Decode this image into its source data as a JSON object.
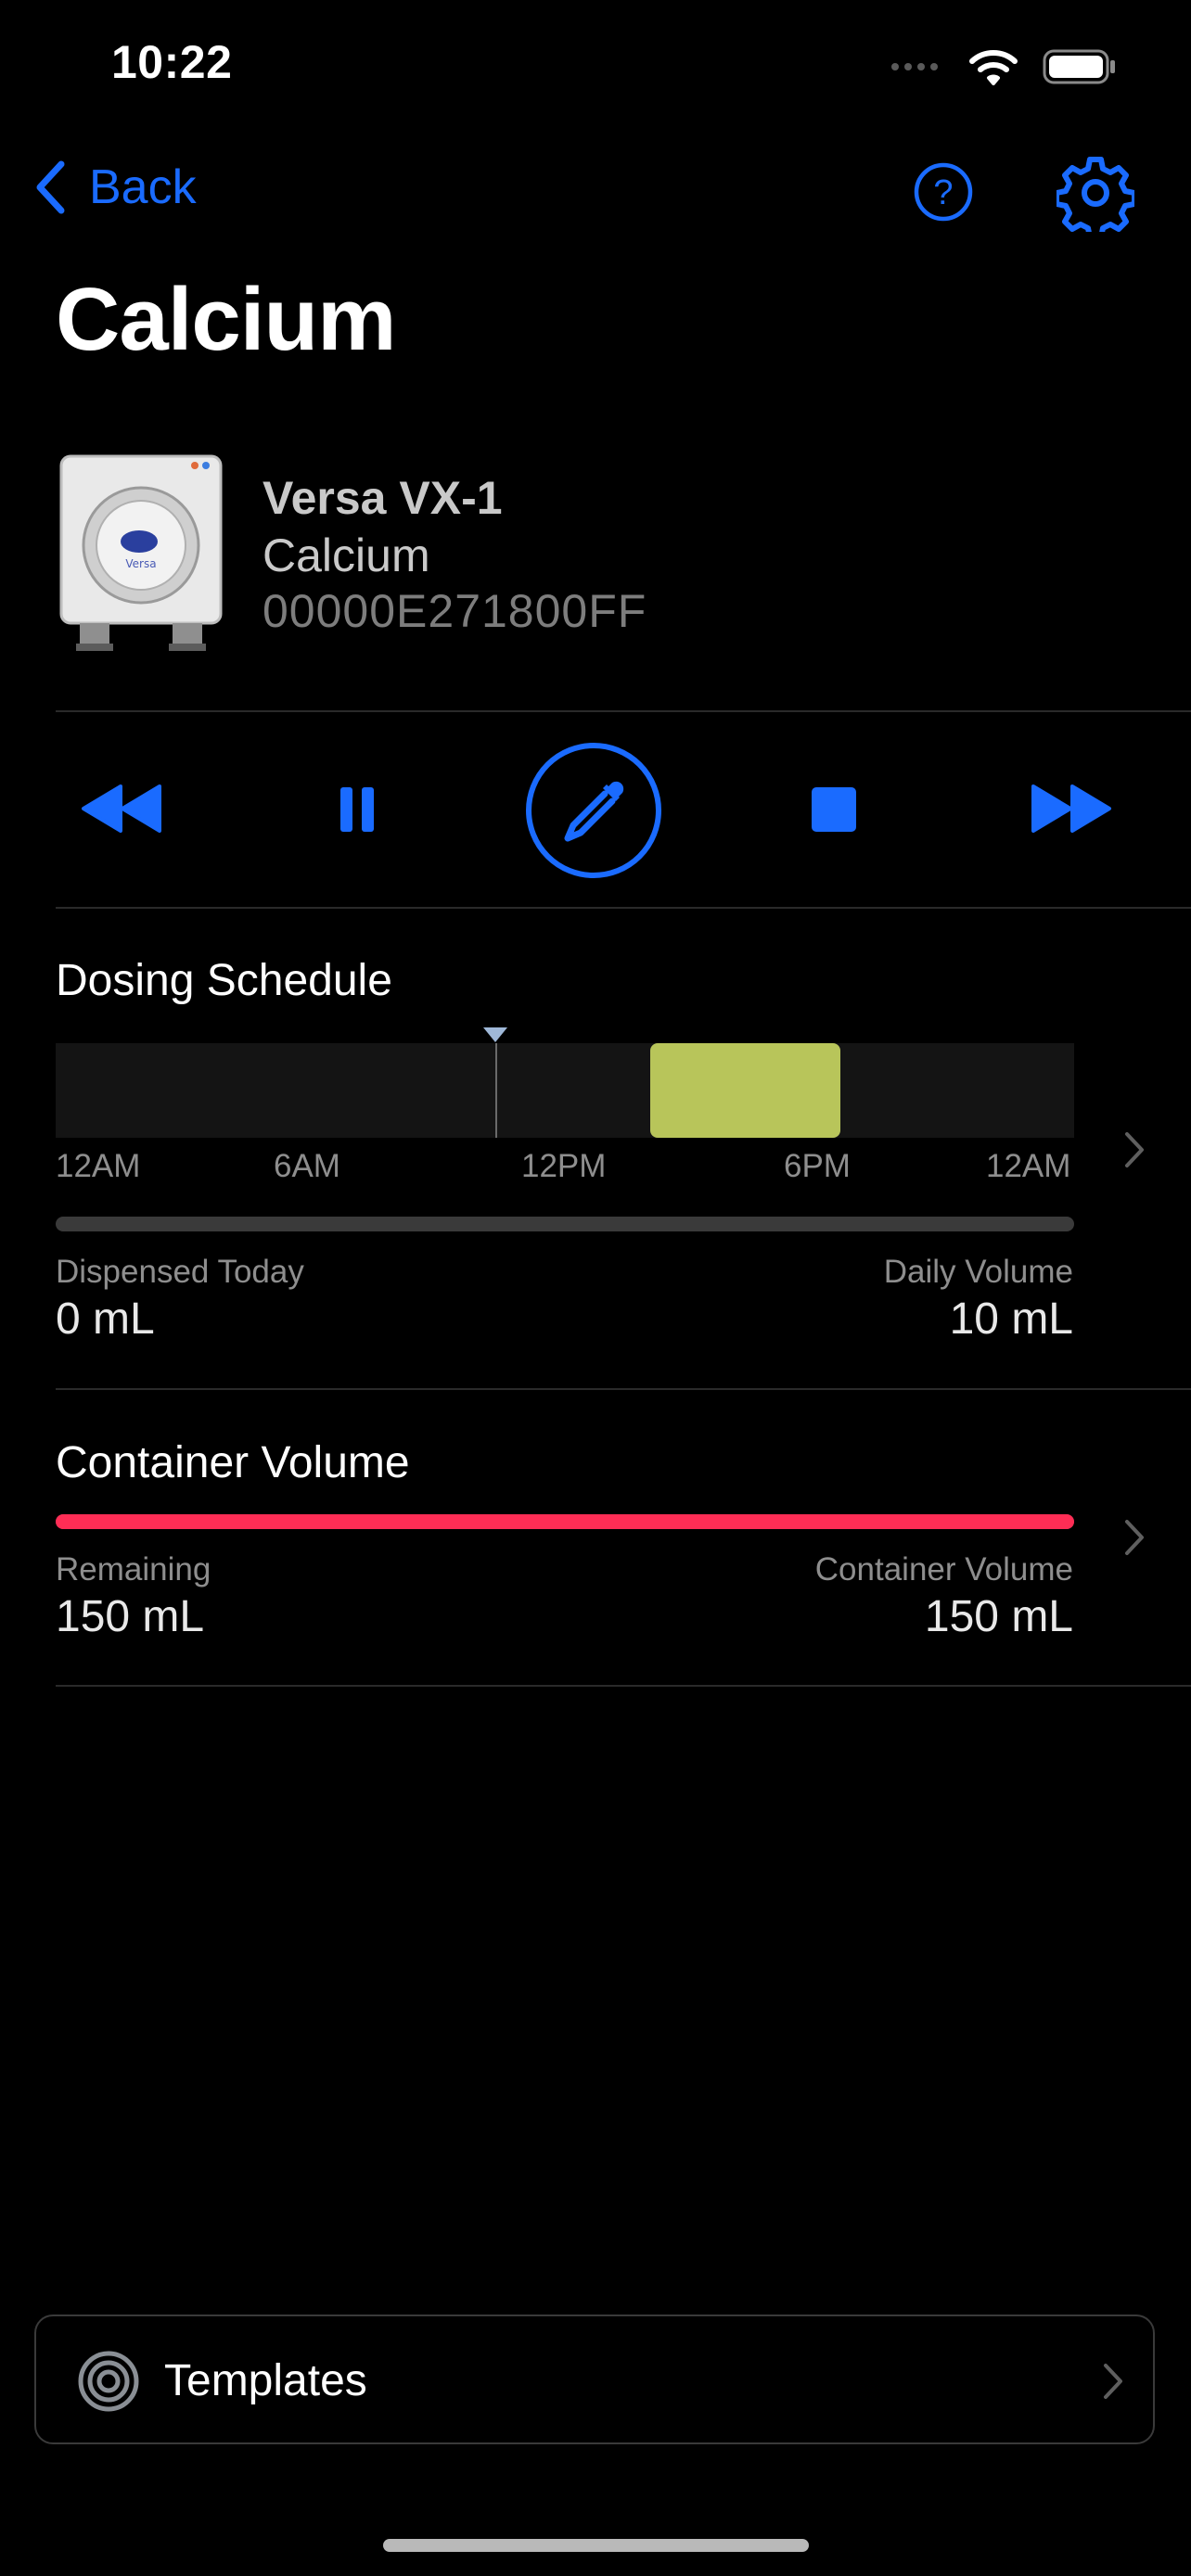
{
  "status_bar": {
    "time": "10:22"
  },
  "nav": {
    "back_label": "Back",
    "help_icon": "question-circle-icon",
    "settings_icon": "gear-icon"
  },
  "page": {
    "title": "Calcium"
  },
  "device": {
    "name": "Versa VX-1",
    "additive": "Calcium",
    "serial": "00000E271800FF",
    "brand_text": "Versa"
  },
  "controls": {
    "icons": [
      "rewind-icon",
      "pause-icon",
      "dropper-icon",
      "stop-icon",
      "fast-forward-icon"
    ]
  },
  "dosing": {
    "title": "Dosing Schedule",
    "ticks": [
      "12AM",
      "6AM",
      "12PM",
      "6PM",
      "12AM"
    ],
    "now_hour": 10.37,
    "dose_window_hours": [
      14,
      18.5
    ],
    "dispensed_label": "Dispensed Today",
    "dispensed_value": "0 mL",
    "daily_label": "Daily Volume",
    "daily_value": "10 mL",
    "progress_fraction": 0,
    "block_color": "#b8c55a"
  },
  "container": {
    "title": "Container Volume",
    "remaining_label": "Remaining",
    "remaining_value": "150 mL",
    "volume_label": "Container Volume",
    "volume_value": "150 mL",
    "fill_fraction": 1.0,
    "bar_color": "#ff2d55"
  },
  "templates": {
    "label": "Templates"
  },
  "colors": {
    "accent": "#1a6bff",
    "background": "#000000"
  }
}
